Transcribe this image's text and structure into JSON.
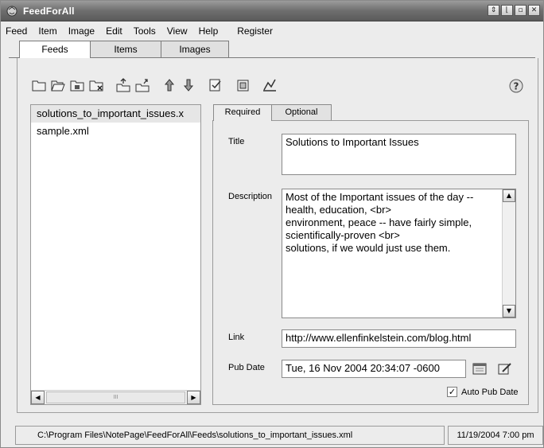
{
  "window": {
    "title": "FeedForAll"
  },
  "window_buttons": [
    "⇕",
    "⌊",
    "▫",
    "✕"
  ],
  "menu": [
    "Feed",
    "Item",
    "Image",
    "Edit",
    "Tools",
    "View",
    "Help",
    "Register"
  ],
  "top_tabs": [
    "Feeds",
    "Items",
    "Images"
  ],
  "file_list": [
    "solutions_to_important_issues.x",
    "sample.xml"
  ],
  "list_scroll_thumb": "III",
  "sub_tabs": [
    "Required",
    "Optional"
  ],
  "form": {
    "title_label": "Title",
    "title_value": "Solutions to Important Issues",
    "description_label": "Description",
    "description_lines": [
      "Most of the Important issues of the day --",
      "health, education, <br>",
      "environment, peace -- have fairly simple,",
      "scientifically-proven <br>",
      "solutions, if we would just use them."
    ],
    "link_label": "Link",
    "link_value": "http://www.ellenfinkelstein.com/blog.html",
    "pubdate_label": "Pub Date",
    "pubdate_value": "Tue, 16 Nov 2004 20:34:07 -0600",
    "auto_pub_label": "Auto Pub Date",
    "auto_pub_checked": "✓"
  },
  "status": {
    "path": "C:\\Program Files\\NotePage\\FeedForAll\\Feeds\\solutions_to_important_issues.xml",
    "time": "11/19/2004 7:00 pm"
  },
  "toolbar_icons": [
    "new-feed-icon",
    "open-feed-icon",
    "save-feed-icon",
    "close-feed-icon",
    "publish-icon",
    "publish-all-icon",
    "move-up-icon",
    "move-down-icon",
    "validate-icon",
    "preview-icon",
    "spell-check-icon"
  ]
}
